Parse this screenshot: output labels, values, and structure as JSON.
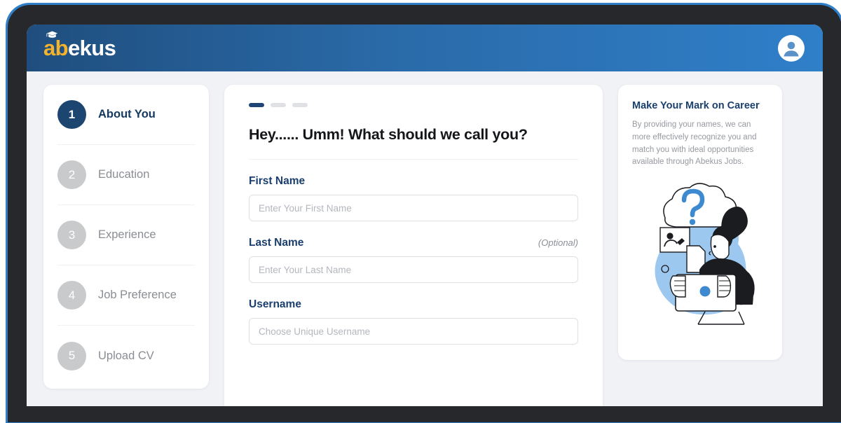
{
  "header": {
    "logo_primary": "ab",
    "logo_secondary": "ekus",
    "logo_full": "abekus",
    "cap_icon": "graduation-cap-icon",
    "avatar_icon": "user-avatar-icon",
    "gradient_from": "#1f4e7e",
    "gradient_to": "#2f7fc9"
  },
  "sidebar": {
    "steps": [
      {
        "number": "1",
        "label": "About You",
        "active": true
      },
      {
        "number": "2",
        "label": "Education",
        "active": false
      },
      {
        "number": "3",
        "label": "Experience",
        "active": false
      },
      {
        "number": "4",
        "label": "Job Preference",
        "active": false
      },
      {
        "number": "5",
        "label": "Upload CV",
        "active": false
      }
    ],
    "active_color": "#1c4570",
    "inactive_color": "#c9cacc"
  },
  "form": {
    "progress": {
      "total": 3,
      "current": 1,
      "active_color": "#1f4576",
      "inactive_color": "#dfe1e5"
    },
    "title": "Hey...... Umm! What should we call you?",
    "fields": [
      {
        "label": "First Name",
        "optional_tag": "",
        "placeholder": "Enter Your First Name",
        "value": ""
      },
      {
        "label": "Last Name",
        "optional_tag": "(Optional)",
        "placeholder": "Enter Your Last Name",
        "value": ""
      },
      {
        "label": "Username",
        "optional_tag": "",
        "placeholder": "Choose Unique Username",
        "value": ""
      }
    ]
  },
  "promo": {
    "title": "Make Your Mark on Career",
    "body": "By providing your names, we can more effectively recognize you and match you with ideal opportunities available through Abekus Jobs.",
    "illustration": "person-with-tablet-thought-cloud-illustration",
    "accent_color": "#8cbdec"
  },
  "theme": {
    "page_background": "#f1f2f6",
    "card_background": "#ffffff",
    "navy": "#1a3f6e",
    "frame_outline": "#2f7fc9",
    "bezel": "#26282b"
  }
}
